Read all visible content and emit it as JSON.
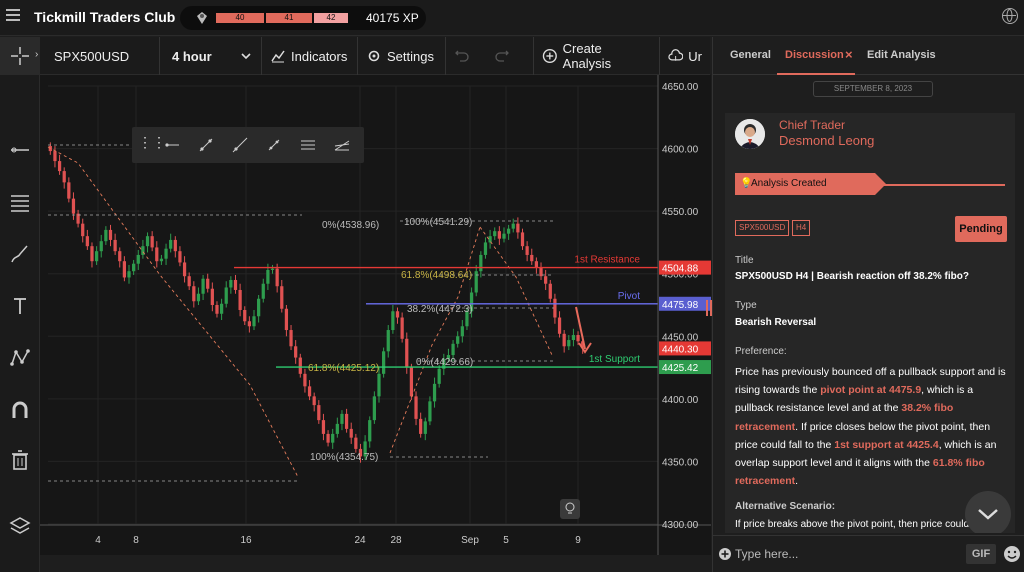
{
  "header": {
    "title": "Tickmill Traders Club",
    "levels": [
      "40",
      "41",
      "42"
    ],
    "xp": "40175 XP"
  },
  "toolbar": {
    "symbol": "SPX500USD",
    "timeframe": "4 hour",
    "indicators_label": "Indicators",
    "settings_label": "Settings",
    "create_label": "Create Analysis",
    "upload_label": "Ur"
  },
  "left_tools": [
    "crosshair-icon",
    "trendline-icon",
    "fibonacci-icon",
    "brush-icon",
    "text-icon",
    "pattern-icon",
    "magnet-icon",
    "trash-icon",
    "layers-icon"
  ],
  "drawing_toolbar": [
    "drag-handle-icon",
    "horizontal-ray-icon",
    "segment-icon",
    "ray-icon",
    "extended-line-icon",
    "parallel-channel-icon",
    "fib-channel-icon"
  ],
  "chart_data": {
    "type": "candlestick",
    "symbol": "SPX500USD",
    "y_ticks": [
      "4650.00",
      "4600.00",
      "4550.00",
      "4500.00",
      "4450.00",
      "4400.00",
      "4350.00",
      "4300.00"
    ],
    "x_ticks": [
      "4",
      "8",
      "16",
      "24",
      "28",
      "Sep",
      "5",
      "9"
    ],
    "ylim": [
      4300,
      4650
    ],
    "price_labels": [
      {
        "label": "4504.88",
        "value": 4504.88,
        "color": "#e53935"
      },
      {
        "label": "4475.98",
        "value": 4475.98,
        "color": "#5a5fd0"
      },
      {
        "label": "4440.30",
        "value": 4440.3,
        "color": "#e53935"
      },
      {
        "label": "4425.42",
        "value": 4425.42,
        "color": "#2e9d4e"
      }
    ],
    "levels": [
      {
        "name": "1st Resistance",
        "value": 4504.88,
        "color": "#e53935"
      },
      {
        "name": "Pivot",
        "value": 4475.98,
        "color": "#6b6ff0"
      },
      {
        "name": "1st Support",
        "value": 4425.42,
        "color": "#2ecc71"
      }
    ],
    "fib_labels": [
      "0%(4538.96)",
      "100%(4541.29)",
      "61.8%(4498.64)",
      "38.2%(4472.3)",
      "0%(4429.66)",
      "61.8%(4425.12)",
      "100%(4354.75)"
    ],
    "close_series": [
      4598,
      4590,
      4582,
      4573,
      4560,
      4548,
      4540,
      4530,
      4522,
      4510,
      4518,
      4526,
      4535,
      4527,
      4518,
      4510,
      4497,
      4502,
      4508,
      4515,
      4522,
      4530,
      4521,
      4510,
      4512,
      4520,
      4527,
      4518,
      4509,
      4498,
      4490,
      4478,
      4484,
      4496,
      4488,
      4475,
      4468,
      4476,
      4489,
      4495,
      4487,
      4471,
      4462,
      4458,
      4466,
      4480,
      4492,
      4503,
      4504,
      4490,
      4472,
      4455,
      4442,
      4433,
      4420,
      4410,
      4402,
      4395,
      4383,
      4372,
      4365,
      4372,
      4380,
      4388,
      4376,
      4369,
      4360,
      4354,
      4366,
      4383,
      4402,
      4420,
      4438,
      4455,
      4470,
      4465,
      4448,
      4425,
      4402,
      4384,
      4372,
      4382,
      4398,
      4412,
      4424,
      4432,
      4435,
      4444,
      4450,
      4458,
      4470,
      4485,
      4502,
      4515,
      4525,
      4530,
      4534,
      4528,
      4532,
      4536,
      4540,
      4533,
      4522,
      4515,
      4510,
      4505,
      4498,
      4492,
      4480,
      4465,
      4452,
      4442,
      4447,
      4451,
      4446,
      4441
    ]
  },
  "right_panel": {
    "tabs": [
      "General",
      "Discussion",
      "Edit Analysis"
    ],
    "close_mark": "×",
    "date": "SEPTEMBER 8, 2023",
    "author_role": "Chief Trader",
    "author_name": "Desmond Leong",
    "status_banner": "Analysis Created",
    "tags": [
      "SPX500USD",
      "H4"
    ],
    "status": "Pending",
    "title_label": "Title",
    "title_value": "SPX500USD H4 | Bearish reaction off 38.2% fibo?",
    "type_label": "Type",
    "type_value": "Bearish Reversal",
    "preference_label": "Preference:",
    "preference_parts": [
      "Price has previously bounced off a pullback support and is rising towards the ",
      "pivot point at 4475.9",
      ", which is a pullback resistance level and at the ",
      "38.2% fibo retracement",
      ". If price closes below the pivot point, then price could fall to the ",
      "1st support at 4425.4",
      ", which is an overlap support level and it aligns with the ",
      "61.8% fibo retracement",
      "."
    ],
    "alt_label": "Alternative Scenario:",
    "alt_text": "If price breaks above the pivot point, then price could",
    "input_placeholder": "Type here...",
    "gif_label": "GIF"
  }
}
